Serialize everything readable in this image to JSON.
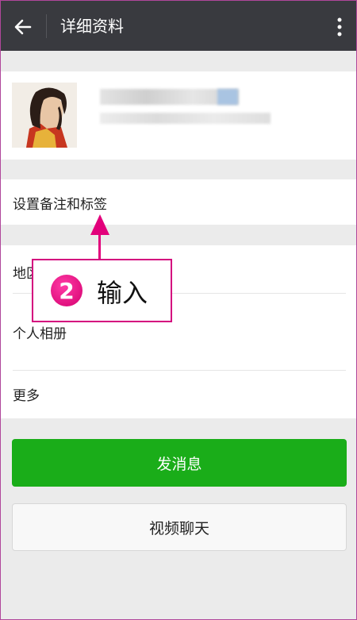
{
  "header": {
    "title": "详细资料"
  },
  "profile": {
    "avatar_alt": "avatar"
  },
  "rows": {
    "remark_tags": "设置备注和标签",
    "region": "地区",
    "album": "个人相册",
    "more": "更多"
  },
  "buttons": {
    "message": "发消息",
    "video_call": "视频聊天"
  },
  "annotation": {
    "step": "2",
    "text": "输入"
  },
  "colors": {
    "titlebar": "#393a3f",
    "primary": "#1aad19",
    "annotation": "#e2007b"
  }
}
